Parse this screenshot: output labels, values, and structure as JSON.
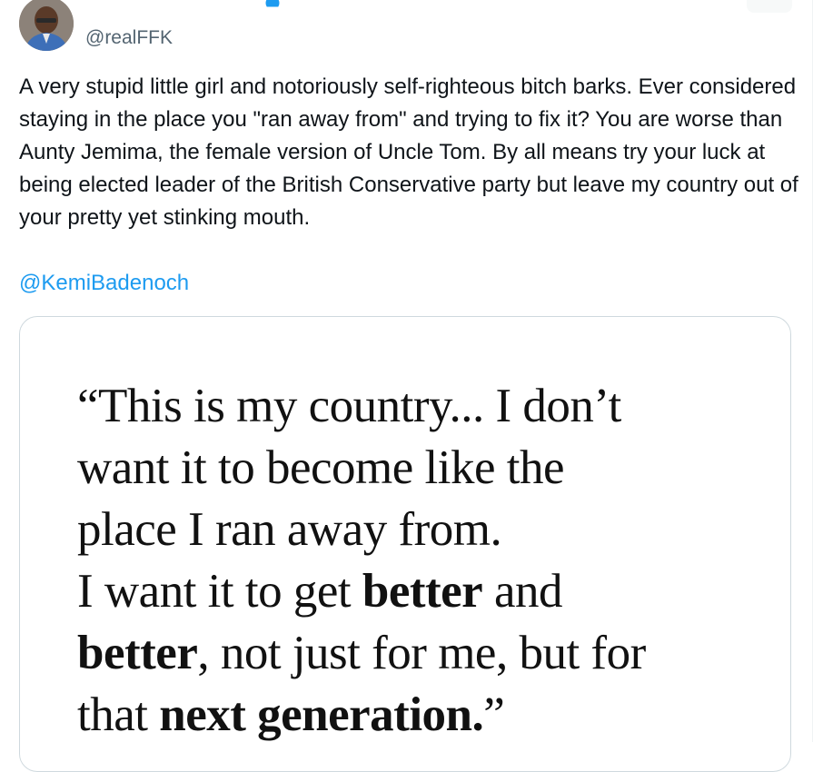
{
  "tweet": {
    "author": {
      "handle": "@realFFK"
    },
    "text": "A very stupid little girl and notoriously self-righteous bitch barks. Ever considered staying in the place you \"ran away from\" and trying to fix it? You are worse than Aunty Jemima, the female version of Uncle Tom. By all means try your luck at being elected leader of the British Conservative party but leave my country out of your pretty yet stinking mouth.",
    "mention": "@KemiBadenoch"
  },
  "media": {
    "quote_lines": [
      [
        {
          "t": "“This is my country... I don’t",
          "b": false
        }
      ],
      [
        {
          "t": "want it to become like the",
          "b": false
        }
      ],
      [
        {
          "t": "place I ran away from.",
          "b": false
        }
      ],
      [
        {
          "t": "I want it to get ",
          "b": false
        },
        {
          "t": "better",
          "b": true
        },
        {
          "t": " and",
          "b": false
        }
      ],
      [
        {
          "t": "better",
          "b": true
        },
        {
          "t": ", not just for me, but for",
          "b": false
        }
      ],
      [
        {
          "t": "that ",
          "b": false
        },
        {
          "t": "next generation.",
          "b": true
        },
        {
          "t": "”",
          "b": false
        }
      ]
    ]
  },
  "icons": {
    "verified": "verified-badge-icon"
  },
  "colors": {
    "text": "#0f1419",
    "secondary": "#536471",
    "link": "#1d9bf0",
    "border": "#cfd9de"
  }
}
